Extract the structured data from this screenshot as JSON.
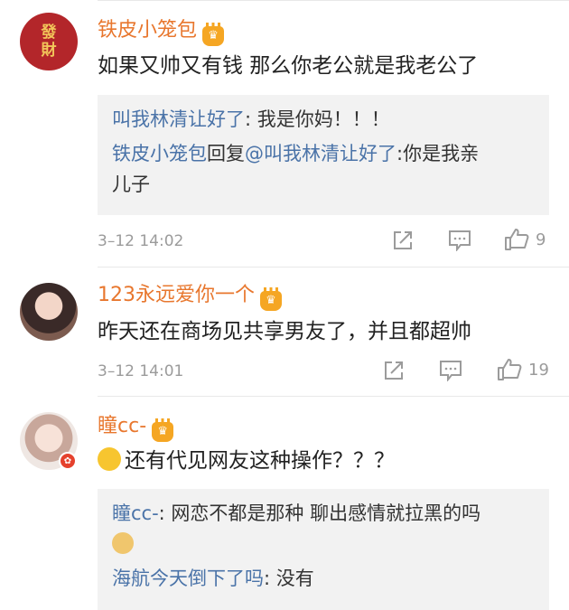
{
  "comments": [
    {
      "username": "铁皮小笼包",
      "text": "如果又帅又有钱 那么你老公就是我老公了",
      "avatar_text_top": "發",
      "avatar_text_bottom": "財",
      "replies": [
        {
          "name": "叫我林清让好了",
          "text": ": 我是你妈！！！"
        },
        {
          "name": "铁皮小笼包",
          "text_mid": "回复",
          "name2": "@叫我林清让好了",
          "text": ":你是我亲",
          "text2": "儿子"
        }
      ],
      "time": "3–12 14:02",
      "likes": "9"
    },
    {
      "username": "123永远爱你一个",
      "text": "昨天还在商场见共享男友了，并且都超帅",
      "time": "3–12 14:01",
      "likes": "19"
    },
    {
      "username": "瞳cc-",
      "text": "还有代见网友这种操作？？？",
      "replies": [
        {
          "name": "瞳cc-",
          "text": ": 网恋不都是那种 聊出感情就拉黑的吗"
        },
        {
          "name": "海航今天倒下了吗",
          "text": ": 没有"
        }
      ]
    }
  ],
  "colors": {
    "username": "#e8772e",
    "reply_name": "#4a73a8",
    "meta": "#9b9b9b",
    "crown": "#f5a623"
  }
}
